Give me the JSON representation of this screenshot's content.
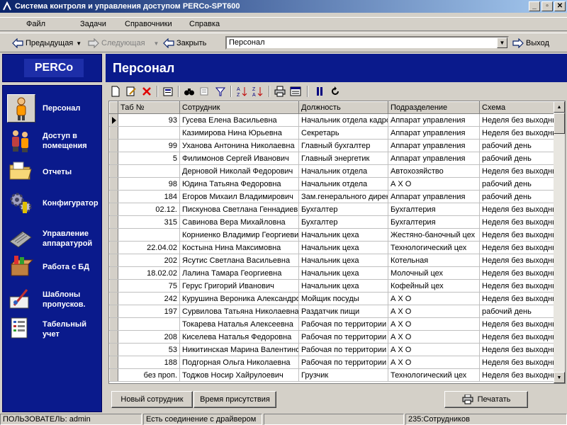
{
  "window": {
    "title": "Система контроля и управления доступом PERCo-SPT600"
  },
  "menu": [
    "Файл",
    "Задачи",
    "Справочники",
    "Справка"
  ],
  "nav": {
    "prev": "Предыдущая",
    "next": "Следующая",
    "close": "Закрыть",
    "path": "Персонал",
    "exit": "Выход"
  },
  "brand": "PERCo",
  "sidebar": [
    {
      "label": "Персонал",
      "icon": "person-icon"
    },
    {
      "label": "Доступ в\nпомещения",
      "icon": "people-icon"
    },
    {
      "label": "Отчеты",
      "icon": "folder-icon"
    },
    {
      "label": "Конфигуратор",
      "icon": "gears-icon"
    },
    {
      "label": "Управление\nаппаратурой",
      "icon": "hardware-icon"
    },
    {
      "label": "Работа с БД",
      "icon": "database-box-icon"
    },
    {
      "label": "Шаблоны\nпропусков.",
      "icon": "pass-template-icon"
    },
    {
      "label": "Табельный\nучет",
      "icon": "timesheet-icon"
    }
  ],
  "header": {
    "title": "Персонал"
  },
  "grid": {
    "columns": [
      "Таб №",
      "Сотрудник",
      "Должность",
      "Подразделение",
      "Схема"
    ],
    "rows": [
      [
        "93",
        "Гусева Елена Васильевна",
        "Начальник отдела кадров",
        "Аппарат управления",
        "Неделя без выходных"
      ],
      [
        "",
        "Казимирова Нина Юрьевна",
        "Секретарь",
        "Аппарат управления",
        "Неделя без выходных"
      ],
      [
        "99",
        "Уханова Антонина Николаевна",
        "Главный бухгалтер",
        "Аппарат управления",
        "рабочий день"
      ],
      [
        "5",
        "Филимонов Сергей Иванович",
        "Главный энергетик",
        "Аппарат управления",
        "рабочий день"
      ],
      [
        "",
        "Дерновой Николай Федорович",
        "Начальник отдела",
        "Автохозяйство",
        "Неделя без выходных"
      ],
      [
        "98",
        "Юдина Татьяна Федоровна",
        "Начальник отдела",
        "А Х О",
        "рабочий день"
      ],
      [
        "184",
        "Егоров Михаил Владимирович",
        "Зам.генерального директора",
        "Аппарат управления",
        "рабочий день"
      ],
      [
        "02.12.",
        "Пискунова Светлана Геннадиевна",
        "Бухгалтер",
        "Бухгалтерия",
        "Неделя без выходных"
      ],
      [
        "315",
        "Савинова Вера Михайловна",
        "Бухгалтер",
        "Бухгалтерия",
        "Неделя без выходных"
      ],
      [
        "",
        "Корниенко Владимир Георгиевич",
        "Начальник цеха",
        "Жестяно-баночный цех",
        "Неделя без выходных"
      ],
      [
        "22.04.02",
        "Костына Нина Максимовна",
        "Начальник цеха",
        "Технологический цех",
        "Неделя без выходных"
      ],
      [
        "202",
        "Ясутис Светлана Васильевна",
        "Начальник цеха",
        "Котельная",
        "Неделя без выходных"
      ],
      [
        "18.02.02",
        "Лалина Тамара Георгиевна",
        "Начальник цеха",
        "Молочный цех",
        "Неделя без выходных"
      ],
      [
        "75",
        "Герус Григорий Иванович",
        "Начальник цеха",
        "Кофейный цех",
        "Неделя без выходных"
      ],
      [
        "242",
        "Курушина Вероника Александровна",
        "Мойщик посуды",
        "А Х О",
        "Неделя без выходных"
      ],
      [
        "197",
        "Сурвилова Татьяна Николаевна",
        "Раздатчик пищи",
        "А Х О",
        "рабочий день"
      ],
      [
        "",
        "Токарева Наталья Алексеевна",
        "Рабочая по территории",
        "А Х О",
        "Неделя без выходных"
      ],
      [
        "208",
        "Киселева Наталья Федоровна",
        "Рабочая по территории",
        "А Х О",
        "Неделя без выходных"
      ],
      [
        "53",
        "Никитинская Марина Валентиновна",
        "Рабочая по территории",
        "А Х О",
        "Неделя без выходных"
      ],
      [
        "188",
        "Подгорная Ольга Николаевна",
        "Рабочая по территории",
        "А Х О",
        "Неделя без выходных"
      ],
      [
        "без проп.",
        "Тоджов Носир Хайрулоевич",
        "Грузчик",
        "Технологический цех",
        "Неделя без выходных"
      ]
    ]
  },
  "buttons": {
    "new_employee": "Новый сотрудник",
    "presence_time": "Время присутствия",
    "print": "Печатать"
  },
  "status": {
    "user": "ПОЛЬЗОВАТЕЛЬ: admin",
    "connection": "Есть соединение с драйвером",
    "count": "235:Сотрудников"
  }
}
